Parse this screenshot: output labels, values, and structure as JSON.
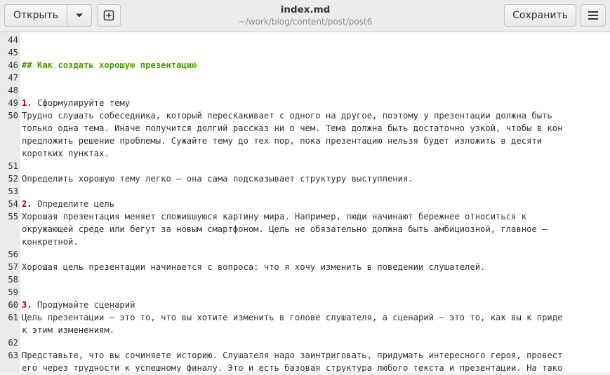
{
  "header": {
    "open_label": "Открыть",
    "title": "index.md",
    "path": "~/work/blog/content/post/post6",
    "save_label": "Сохранить",
    "icons": {
      "open_menu": "chevron-down-icon",
      "new_tab": "new-document-icon",
      "main_menu": "hamburger-menu-icon"
    }
  },
  "editor": {
    "colors": {
      "heading": "#4e9a06",
      "list_number": "#a40000",
      "text": "#2e3436",
      "gutter": "#ebebeb"
    },
    "lines": [
      {
        "n": "44",
        "text": ""
      },
      {
        "n": "45",
        "text": ""
      },
      {
        "n": "46",
        "text": "## Как создать хорошую презентацию"
      },
      {
        "n": "47",
        "text": ""
      },
      {
        "n": "48",
        "text": ""
      },
      {
        "n": "49",
        "num": "1.",
        "text": " Сформулируйте тему"
      },
      {
        "n": "50",
        "text": "Трудно слушать собеседника, который перескакивает с одного на другое, поэтому у презентации должна быть"
      },
      {
        "n": "",
        "text": "только одна тема. Иначе получится долгий рассказ ни о чем. Тема должна быть достаточно узкой, чтобы в кон"
      },
      {
        "n": "",
        "text": "предложить решение проблемы. Сужайте тему до тех пор, пока презентацию нельзя будет изложить в десяти"
      },
      {
        "n": "",
        "text": "коротких пунктах."
      },
      {
        "n": "51",
        "text": ""
      },
      {
        "n": "52",
        "text": "Определить хорошую тему легко — она сама подсказывает структуру выступления."
      },
      {
        "n": "53",
        "text": ""
      },
      {
        "n": "54",
        "num": "2.",
        "text": " Определите цель"
      },
      {
        "n": "55",
        "text": "Хорошая презентация меняет сложившуюся картину мира. Например, люди начинают бережнее относиться к"
      },
      {
        "n": "",
        "text": "окружающей среде или бегут за новым смартфоном. Цель не обязательно должна быть амбициозной, главное —"
      },
      {
        "n": "",
        "text": "конкретной."
      },
      {
        "n": "56",
        "text": ""
      },
      {
        "n": "57",
        "text": "Хорошая цель презентации начинается с вопроса: что я хочу изменить в поведении слушателей."
      },
      {
        "n": "58",
        "text": ""
      },
      {
        "n": "59",
        "text": ""
      },
      {
        "n": "60",
        "num": "3.",
        "text": " Продумайте сценарий"
      },
      {
        "n": "61",
        "text": "Цель презентации — это то, что вы хотите изменить в голове слушателя, а сценарий — это то, как вы к приде"
      },
      {
        "n": "",
        "text": "к этим изменениям."
      },
      {
        "n": "62",
        "text": ""
      },
      {
        "n": "63",
        "text": "Представьте, что вы сочиняете историю. Слушателя надо заинтриговать, придумать интересного героя, провест"
      },
      {
        "n": "",
        "text": "его через трудности к успешному финалу. Это и есть базовая структура любого текста и презентации. На тако"
      }
    ]
  }
}
